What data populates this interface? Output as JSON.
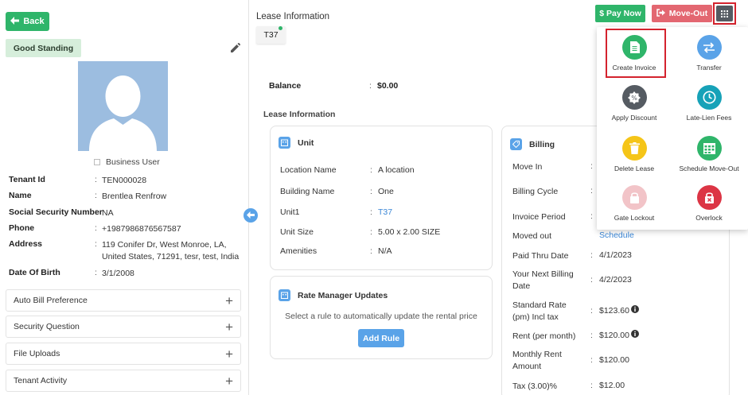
{
  "left": {
    "back_label": "Back",
    "standing_label": "Good Standing",
    "business_user_label": "Business User",
    "fields": [
      {
        "label": "Tenant Id",
        "value": "TEN000028"
      },
      {
        "label": "Name",
        "value": "Brentlea Renfrow"
      },
      {
        "label": "Social Security Number",
        "value": "NA"
      },
      {
        "label": "Phone",
        "value": "+1987986876567587"
      },
      {
        "label": "Address",
        "value": "119 Conifer Dr, West Monroe, LA, United States, 71291, tesr, test, India"
      },
      {
        "label": "Date Of Birth",
        "value": "3/1/2008"
      }
    ],
    "accordions": [
      "Auto Bill Preference",
      "Security Question",
      "File Uploads",
      "Tenant Activity"
    ]
  },
  "main": {
    "header": "Lease Information",
    "tab_label": "T37",
    "balance_label": "Balance",
    "balance_value": "$0.00",
    "section_label": "Lease Information",
    "unit_card": {
      "title": "Unit",
      "rows": [
        {
          "k": "Location Name",
          "v": "A location"
        },
        {
          "k": "Building Name",
          "v": "One"
        },
        {
          "k": "Unit1",
          "v": "T37"
        },
        {
          "k": "Unit Size",
          "v": "5.00 x 2.00 SIZE"
        },
        {
          "k": "Amenities",
          "v": "N/A"
        }
      ]
    },
    "rate_card": {
      "title": "Rate Manager Updates",
      "text": "Select a rule to automatically update the rental price",
      "button": "Add Rule"
    },
    "billing_card": {
      "title": "Billing",
      "rows": [
        {
          "k": "Move In",
          "v": ""
        },
        {
          "k": "Billing Cycle",
          "v": ""
        },
        {
          "k": "Invoice Period",
          "v": ""
        },
        {
          "k": "Moved out",
          "v": "Schedule"
        },
        {
          "k": "Paid Thru Date",
          "v": "4/1/2023"
        },
        {
          "k": "Your Next Billing Date",
          "v": "4/2/2023"
        },
        {
          "k": "Standard Rate (pm) Incl tax",
          "v": "$123.60"
        },
        {
          "k": "Rent (per month)",
          "v": "$120.00"
        },
        {
          "k": "Monthly Rent Amount",
          "v": "$120.00"
        },
        {
          "k": "Tax (3.00)%",
          "v": "$12.00"
        }
      ]
    }
  },
  "actions": {
    "pay_now": "Pay Now",
    "move_out": "Move-Out",
    "menu": [
      {
        "label": "Create Invoice",
        "color": "#2fb56a"
      },
      {
        "label": "Transfer",
        "color": "#5aa3e8"
      },
      {
        "label": "Apply Discount",
        "color": "#555b62"
      },
      {
        "label": "Late-Lien Fees",
        "color": "#17a2b8"
      },
      {
        "label": "Delete Lease",
        "color": "#f5c518"
      },
      {
        "label": "Schedule Move-Out",
        "color": "#2fb56a"
      },
      {
        "label": "Gate Lockout",
        "color": "#f2c4c8"
      },
      {
        "label": "Overlock",
        "color": "#dc3545"
      }
    ]
  }
}
